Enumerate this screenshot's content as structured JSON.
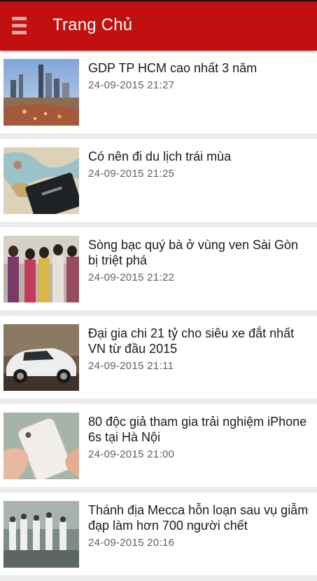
{
  "header": {
    "title": "Trang Chủ",
    "menu_icon": "hamburger-menu-icon",
    "color": "#c0100f"
  },
  "articles": [
    {
      "title": "GDP TP HCM cao nhất 3 năm",
      "time": "24-09-2015 21:27",
      "image": "city-skyline"
    },
    {
      "title": "Có nên đi du lịch trái mùa",
      "time": "24-09-2015 21:25",
      "image": "passport-on-map"
    },
    {
      "title": "Sòng bạc quý bà ở vùng ven Sài Gòn bị triệt phá",
      "time": "24-09-2015 21:22",
      "image": "group-of-women"
    },
    {
      "title": "Đại gia chi 21 tỷ cho siêu xe đắt nhất VN từ đầu 2015",
      "time": "24-09-2015 21:11",
      "image": "white-sports-car"
    },
    {
      "title": "80 độc giả tham gia trải nghiệm iPhone 6s tại Hà Nội",
      "time": "24-09-2015 21:00",
      "image": "hand-holding-iphone"
    },
    {
      "title": "Thánh địa Mecca hỗn loạn sau vụ giẫm đạp làm hơn 700 người chết",
      "time": "24-09-2015 20:16",
      "image": "crowd-scene"
    }
  ]
}
